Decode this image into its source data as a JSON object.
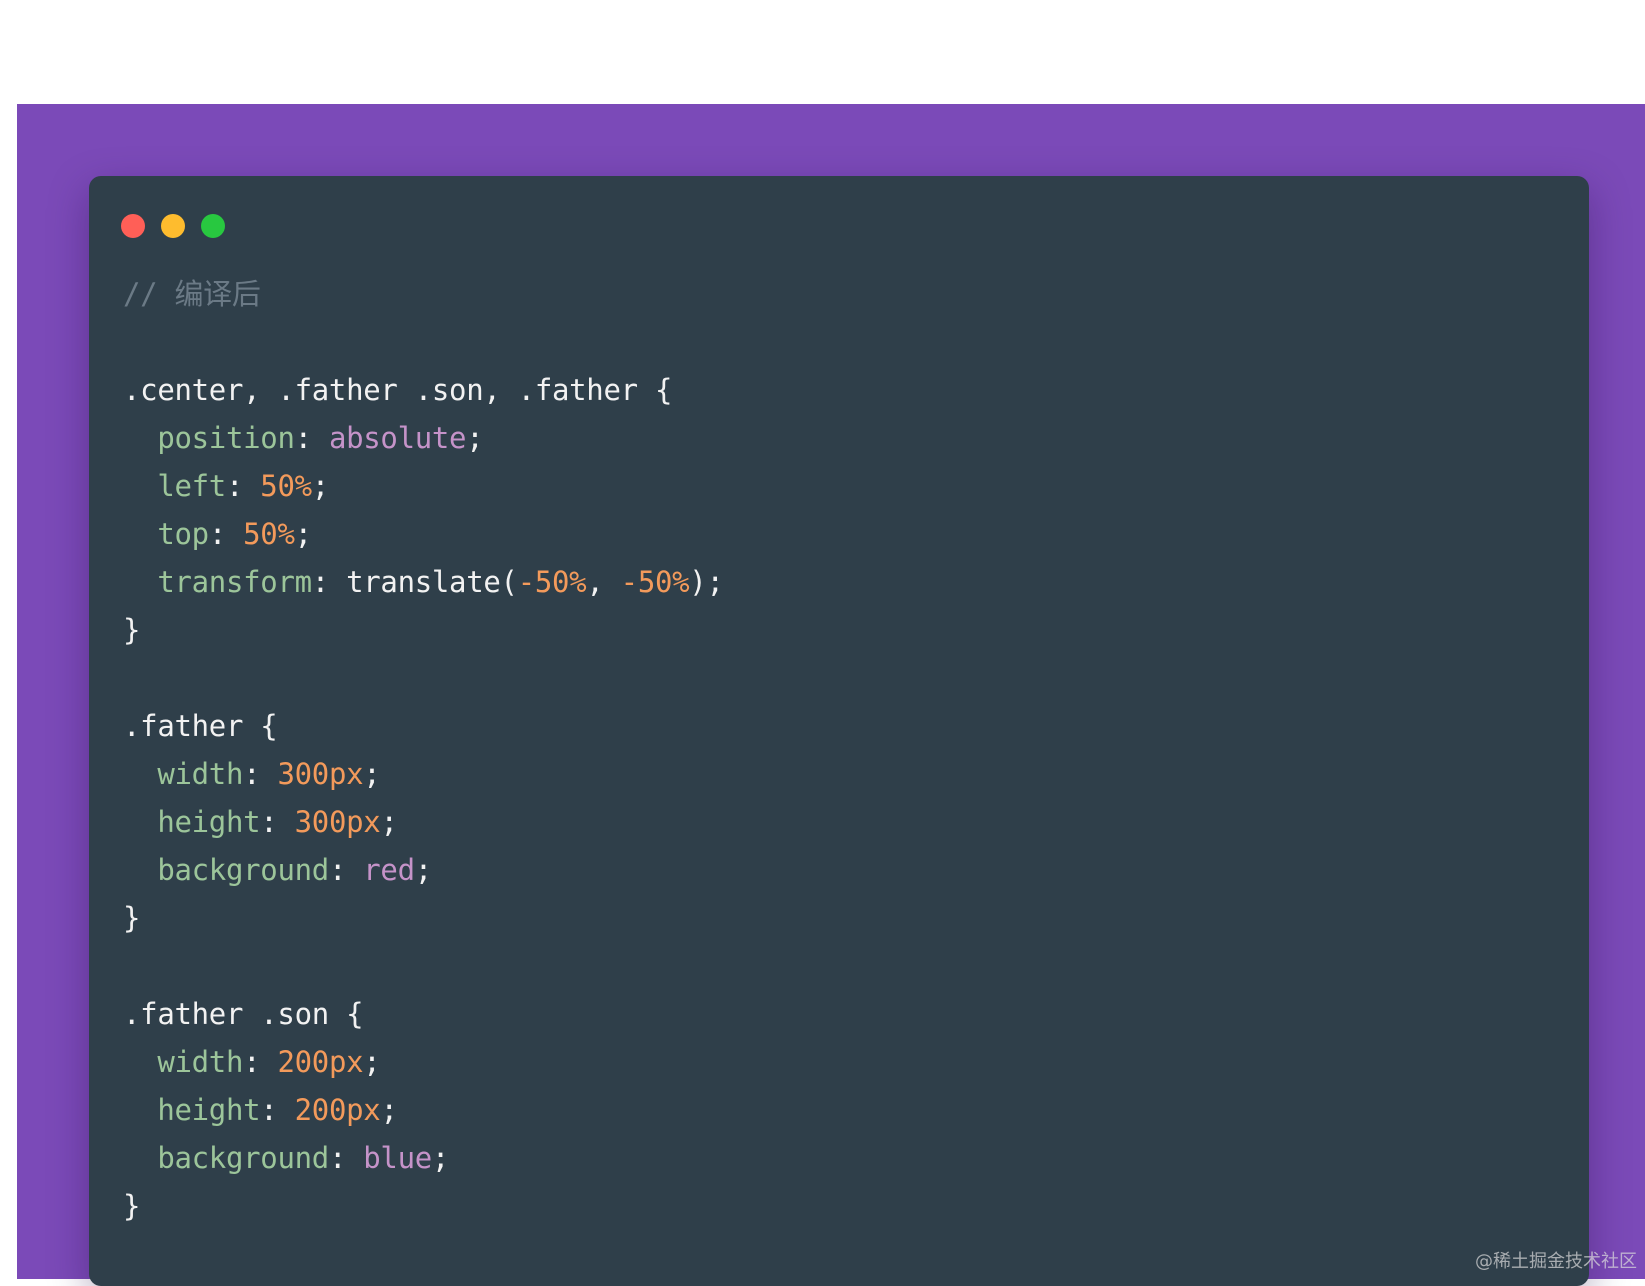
{
  "colors": {
    "background": "#7b4ab8",
    "window": "#2f3f4a",
    "dot_close": "#ff5f57",
    "dot_minimize": "#febc2e",
    "dot_maximize": "#28c840",
    "comment": "#6b7a86",
    "selector": "#f2f2f2",
    "property": "#9cc59a",
    "keyword_value": "#c593c9",
    "number": "#f39a5b",
    "punctuation": "#f2f2f2"
  },
  "window_controls": [
    "close",
    "minimize",
    "maximize"
  ],
  "code_lines": [
    [
      {
        "t": "// 编译后",
        "c": "comment"
      }
    ],
    [],
    [
      {
        "t": ".center, .father .son, .father {",
        "c": "selector"
      }
    ],
    [
      {
        "t": "  "
      },
      {
        "t": "position",
        "c": "property"
      },
      {
        "t": ": ",
        "c": "punctuation"
      },
      {
        "t": "absolute",
        "c": "keyword_value"
      },
      {
        "t": ";",
        "c": "punctuation"
      }
    ],
    [
      {
        "t": "  "
      },
      {
        "t": "left",
        "c": "property"
      },
      {
        "t": ": ",
        "c": "punctuation"
      },
      {
        "t": "50%",
        "c": "number"
      },
      {
        "t": ";",
        "c": "punctuation"
      }
    ],
    [
      {
        "t": "  "
      },
      {
        "t": "top",
        "c": "property"
      },
      {
        "t": ": ",
        "c": "punctuation"
      },
      {
        "t": "50%",
        "c": "number"
      },
      {
        "t": ";",
        "c": "punctuation"
      }
    ],
    [
      {
        "t": "  "
      },
      {
        "t": "transform",
        "c": "property"
      },
      {
        "t": ": translate(",
        "c": "punctuation"
      },
      {
        "t": "-50%",
        "c": "number"
      },
      {
        "t": ", ",
        "c": "punctuation"
      },
      {
        "t": "-50%",
        "c": "number"
      },
      {
        "t": ");",
        "c": "punctuation"
      }
    ],
    [
      {
        "t": "}",
        "c": "punctuation"
      }
    ],
    [],
    [
      {
        "t": ".father {",
        "c": "selector"
      }
    ],
    [
      {
        "t": "  "
      },
      {
        "t": "width",
        "c": "property"
      },
      {
        "t": ": ",
        "c": "punctuation"
      },
      {
        "t": "300px",
        "c": "number"
      },
      {
        "t": ";",
        "c": "punctuation"
      }
    ],
    [
      {
        "t": "  "
      },
      {
        "t": "height",
        "c": "property"
      },
      {
        "t": ": ",
        "c": "punctuation"
      },
      {
        "t": "300px",
        "c": "number"
      },
      {
        "t": ";",
        "c": "punctuation"
      }
    ],
    [
      {
        "t": "  "
      },
      {
        "t": "background",
        "c": "property"
      },
      {
        "t": ": ",
        "c": "punctuation"
      },
      {
        "t": "red",
        "c": "keyword_value"
      },
      {
        "t": ";",
        "c": "punctuation"
      }
    ],
    [
      {
        "t": "}",
        "c": "punctuation"
      }
    ],
    [],
    [
      {
        "t": ".father .son {",
        "c": "selector"
      }
    ],
    [
      {
        "t": "  "
      },
      {
        "t": "width",
        "c": "property"
      },
      {
        "t": ": ",
        "c": "punctuation"
      },
      {
        "t": "200px",
        "c": "number"
      },
      {
        "t": ";",
        "c": "punctuation"
      }
    ],
    [
      {
        "t": "  "
      },
      {
        "t": "height",
        "c": "property"
      },
      {
        "t": ": ",
        "c": "punctuation"
      },
      {
        "t": "200px",
        "c": "number"
      },
      {
        "t": ";",
        "c": "punctuation"
      }
    ],
    [
      {
        "t": "  "
      },
      {
        "t": "background",
        "c": "property"
      },
      {
        "t": ": ",
        "c": "punctuation"
      },
      {
        "t": "blue",
        "c": "keyword_value"
      },
      {
        "t": ";",
        "c": "punctuation"
      }
    ],
    [
      {
        "t": "}",
        "c": "punctuation"
      }
    ]
  ],
  "watermark": "@稀土掘金技术社区"
}
